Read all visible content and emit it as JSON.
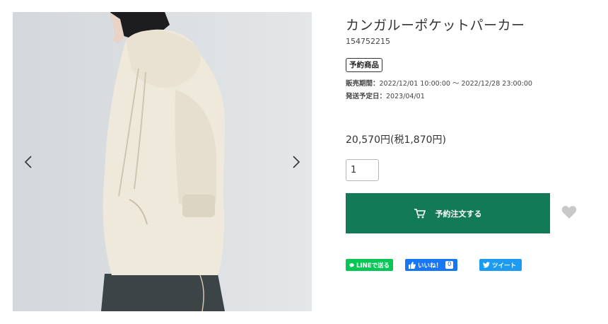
{
  "product": {
    "title": "カンガルーポケットパーカー",
    "id": "154752215",
    "badge": "予約商品",
    "sales_period_label": "販売期間：",
    "sales_period_value": "2022/12/01 10:00:00 〜 2022/12/28 23:00:00",
    "ship_date_label": "発送予定日：",
    "ship_date_value": "2023/04/01",
    "price": "20,570円(税1,870円)"
  },
  "quantity": {
    "value": "1"
  },
  "actions": {
    "reserve_label": "予約注文する"
  },
  "share": {
    "line_label": "LINEで送る",
    "like_label": "いいね！",
    "like_count": "0",
    "tweet_label": "ツイート"
  },
  "colors": {
    "reserve_button": "#137a57",
    "line": "#06c755",
    "facebook": "#1877f2",
    "twitter": "#1d9bf0"
  }
}
